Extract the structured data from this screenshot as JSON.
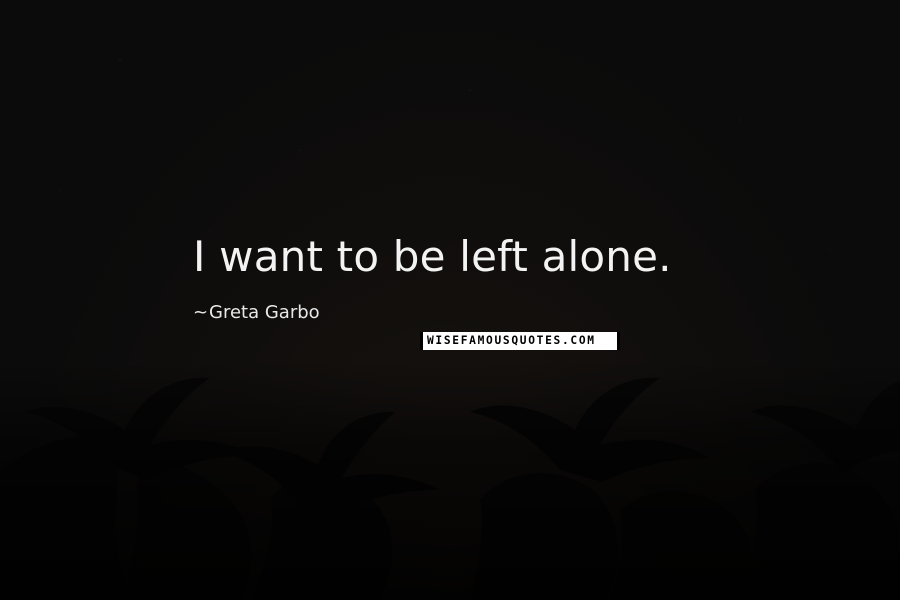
{
  "quote": {
    "text": "I want to be left alone.",
    "author": "Greta Garbo"
  },
  "watermark": {
    "text": "WISEFAMOUSQUOTES.COM"
  },
  "icons": {
    "author_prefix": "dash-icon"
  },
  "colors": {
    "background": "#0b0b0b",
    "text": "#f3f3f3",
    "watermark_bg": "#ffffff",
    "watermark_text": "#000000"
  }
}
